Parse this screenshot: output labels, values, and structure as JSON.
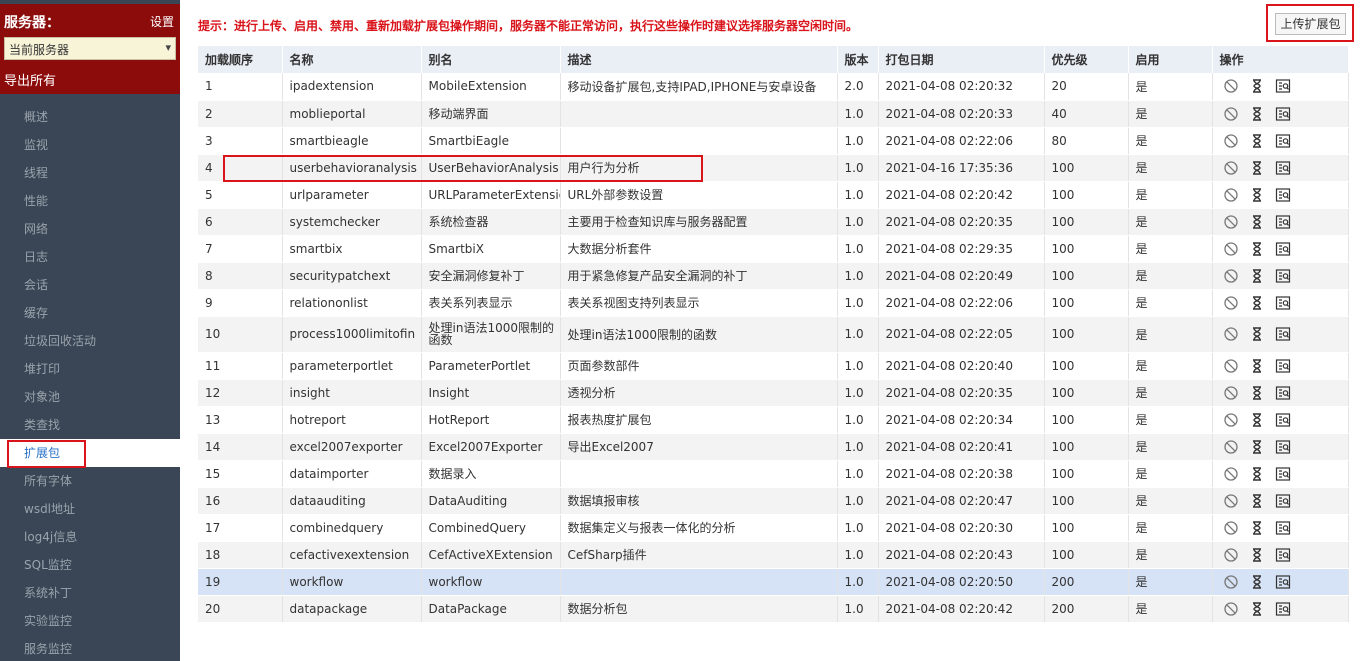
{
  "sidebar": {
    "title": "服务器：",
    "settings": "设置",
    "server_select": "当前服务器",
    "export_all": "导出所有",
    "items": [
      {
        "label": "概述"
      },
      {
        "label": "监视"
      },
      {
        "label": "线程"
      },
      {
        "label": "性能"
      },
      {
        "label": "网络"
      },
      {
        "label": "日志"
      },
      {
        "label": "会话"
      },
      {
        "label": "缓存"
      },
      {
        "label": "垃圾回收活动"
      },
      {
        "label": "堆打印"
      },
      {
        "label": "对象池"
      },
      {
        "label": "类查找"
      },
      {
        "label": "扩展包",
        "active": true
      },
      {
        "label": "所有字体"
      },
      {
        "label": "wsdl地址"
      },
      {
        "label": "log4j信息"
      },
      {
        "label": "SQL监控"
      },
      {
        "label": "系统补丁"
      },
      {
        "label": "实验监控"
      },
      {
        "label": "服务监控"
      }
    ]
  },
  "main": {
    "tip": "提示：进行上传、启用、禁用、重新加载扩展包操作期间，服务器不能正常访问，执行这些操作时建议选择服务器空闲时间。",
    "upload_button": "上传扩展包",
    "columns": [
      "加载顺序",
      "名称",
      "别名",
      "描述",
      "版本",
      "打包日期",
      "优先级",
      "启用",
      "操作"
    ],
    "rows": [
      {
        "order": "1",
        "name": "ipadextension",
        "alias": "MobileExtension",
        "desc": "移动设备扩展包,支持IPAD,IPHONE与安卓设备",
        "version": "2.0",
        "date": "2021-04-08 02:20:32",
        "priority": "20",
        "enabled": "是"
      },
      {
        "order": "2",
        "name": "moblieportal",
        "alias": "移动端界面",
        "desc": "",
        "version": "1.0",
        "date": "2021-04-08 02:20:33",
        "priority": "40",
        "enabled": "是"
      },
      {
        "order": "3",
        "name": "smartbieagle",
        "alias": "SmartbiEagle",
        "desc": "",
        "version": "1.0",
        "date": "2021-04-08 02:22:06",
        "priority": "80",
        "enabled": "是"
      },
      {
        "order": "4",
        "name": "userbehavioranalysis",
        "alias": "UserBehaviorAnalysis",
        "desc": "用户行为分析",
        "version": "1.0",
        "date": "2021-04-16 17:35:36",
        "priority": "100",
        "enabled": "是"
      },
      {
        "order": "5",
        "name": "urlparameter",
        "alias": "URLParameterExtension",
        "desc": "URL外部参数设置",
        "version": "1.0",
        "date": "2021-04-08 02:20:42",
        "priority": "100",
        "enabled": "是"
      },
      {
        "order": "6",
        "name": "systemchecker",
        "alias": "系统检查器",
        "desc": "主要用于检查知识库与服务器配置",
        "version": "1.0",
        "date": "2021-04-08 02:20:35",
        "priority": "100",
        "enabled": "是"
      },
      {
        "order": "7",
        "name": "smartbix",
        "alias": "SmartbiX",
        "desc": "大数据分析套件",
        "version": "1.0",
        "date": "2021-04-08 02:29:35",
        "priority": "100",
        "enabled": "是"
      },
      {
        "order": "8",
        "name": "securitypatchext",
        "alias": "安全漏洞修复补丁",
        "desc": "用于紧急修复产品安全漏洞的补丁",
        "version": "1.0",
        "date": "2021-04-08 02:20:49",
        "priority": "100",
        "enabled": "是"
      },
      {
        "order": "9",
        "name": "relationonlist",
        "alias": "表关系列表显示",
        "desc": "表关系视图支持列表显示",
        "version": "1.0",
        "date": "2021-04-08 02:22:06",
        "priority": "100",
        "enabled": "是"
      },
      {
        "order": "10",
        "name": "process1000limitofin",
        "alias": "处理in语法1000限制的函数",
        "desc": "处理in语法1000限制的函数",
        "version": "1.0",
        "date": "2021-04-08 02:22:05",
        "priority": "100",
        "enabled": "是",
        "tall": true
      },
      {
        "order": "11",
        "name": "parameterportlet",
        "alias": "ParameterPortlet",
        "desc": "页面参数部件",
        "version": "1.0",
        "date": "2021-04-08 02:20:40",
        "priority": "100",
        "enabled": "是"
      },
      {
        "order": "12",
        "name": "insight",
        "alias": "Insight",
        "desc": "透视分析",
        "version": "1.0",
        "date": "2021-04-08 02:20:35",
        "priority": "100",
        "enabled": "是"
      },
      {
        "order": "13",
        "name": "hotreport",
        "alias": "HotReport",
        "desc": "报表热度扩展包",
        "version": "1.0",
        "date": "2021-04-08 02:20:34",
        "priority": "100",
        "enabled": "是"
      },
      {
        "order": "14",
        "name": "excel2007exporter",
        "alias": "Excel2007Exporter",
        "desc": "导出Excel2007",
        "version": "1.0",
        "date": "2021-04-08 02:20:41",
        "priority": "100",
        "enabled": "是"
      },
      {
        "order": "15",
        "name": "dataimporter",
        "alias": "数据录入",
        "desc": "",
        "version": "1.0",
        "date": "2021-04-08 02:20:38",
        "priority": "100",
        "enabled": "是"
      },
      {
        "order": "16",
        "name": "dataauditing",
        "alias": "DataAuditing",
        "desc": "数据填报审核",
        "version": "1.0",
        "date": "2021-04-08 02:20:47",
        "priority": "100",
        "enabled": "是"
      },
      {
        "order": "17",
        "name": "combinedquery",
        "alias": "CombinedQuery",
        "desc": "数据集定义与报表一体化的分析",
        "version": "1.0",
        "date": "2021-04-08 02:20:30",
        "priority": "100",
        "enabled": "是"
      },
      {
        "order": "18",
        "name": "cefactivexextension",
        "alias": "CefActiveXExtension",
        "desc": "CefSharp插件",
        "version": "1.0",
        "date": "2021-04-08 02:20:43",
        "priority": "100",
        "enabled": "是"
      },
      {
        "order": "19",
        "name": "workflow",
        "alias": "workflow",
        "desc": "",
        "version": "1.0",
        "date": "2021-04-08 02:20:50",
        "priority": "200",
        "enabled": "是",
        "selected": true
      },
      {
        "order": "20",
        "name": "datapackage",
        "alias": "DataPackage",
        "desc": "数据分析包",
        "version": "1.0",
        "date": "2021-04-08 02:20:42",
        "priority": "200",
        "enabled": "是"
      }
    ]
  },
  "colors": {
    "sidebar_bg": "#3a4655",
    "header_red": "#8c0c0c",
    "tip_red": "#d9141b",
    "selected_row": "#d6e2f5"
  },
  "icons": {
    "disable": "disable-icon",
    "reload": "hourglass-icon",
    "info": "eq-icon"
  }
}
